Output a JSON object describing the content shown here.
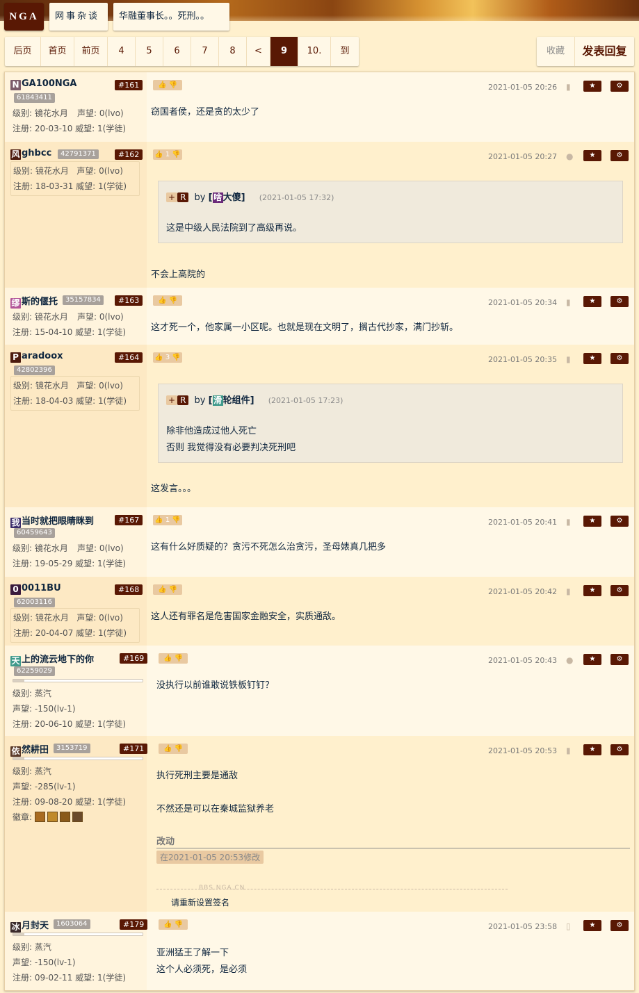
{
  "header": {
    "logo": "NGA",
    "forum": "网事杂谈",
    "thread": "华融董事长。。死刑。。"
  },
  "pager": {
    "items": [
      "后页",
      "首页",
      "前页",
      "4",
      "5",
      "6",
      "7",
      "8",
      "<",
      "9",
      "10.",
      "到"
    ],
    "current": "9"
  },
  "actions": {
    "favorite": "收藏",
    "reply": "发表回复"
  },
  "colors": {
    "brand": "#591804",
    "row_a": "#fff8e7",
    "row_b": "#fff0cd",
    "accent": "#e9c9a1"
  },
  "posts": [
    {
      "initial": "N",
      "initial_color": "#7b5b6a",
      "name": "GA100NGA",
      "uid": "61843411",
      "floor": "#161",
      "level": "级别: 镜花水月",
      "rep": "声望: 0(lvo)",
      "reg": "注册: 20-03-10 威望: 1(学徒)",
      "vote": "",
      "time": "2021-01-05 20:26",
      "device": "android-icon",
      "content": [
        "窃国者侯，还是贪的太少了"
      ]
    },
    {
      "initial": "风",
      "initial_color": "#4c1b0e",
      "name": "ghbcc",
      "uid": "42791371",
      "floor": "#162",
      "level": "级别: 镜花水月",
      "rep": "声望: 0(lvo)",
      "reg": "注册: 18-03-31 威望: 1(学徒)",
      "vote": "1",
      "time": "2021-01-05 20:27",
      "device": "apple-icon",
      "quote": {
        "plus": "+",
        "r": "R",
        "by": "by",
        "initial": "啥",
        "name": "大傻",
        "time": "(2021-01-05 17:32)",
        "lines": [
          "这是中级人民法院到了高级再说。"
        ]
      },
      "content": [
        "不会上高院的"
      ]
    },
    {
      "initial": "缪",
      "initial_color": "#b25599",
      "name": "斯的偃托",
      "uid": "35157834",
      "floor": "#163",
      "level": "级别: 镜花水月",
      "rep": "声望: 0(lvo)",
      "reg": "注册: 15-04-10 威望: 1(学徒)",
      "vote": "",
      "time": "2021-01-05 20:34",
      "device": "android-icon",
      "content": [
        "这才死一个，他家属一小区呢。也就是现在文明了，搁古代抄家，满门抄斩。"
      ]
    },
    {
      "initial": "P",
      "initial_color": "#4c1b0e",
      "name": "aradoox",
      "uid": "42802396",
      "floor": "#164",
      "level": "级别: 镜花水月",
      "rep": "声望: 0(lvo)",
      "reg": "注册: 18-04-03 威望: 1(学徒)",
      "vote": "3",
      "time": "2021-01-05 20:35",
      "device": "android-icon",
      "quote": {
        "plus": "+",
        "r": "R",
        "by": "by",
        "initial": "滑",
        "name": "轮组件",
        "time": "(2021-01-05 17:23)",
        "lines": [
          "除非他造成过他人死亡",
          "否则 我觉得没有必要判决死刑吧"
        ]
      },
      "content": [
        "这发言。。。"
      ]
    },
    {
      "initial": "我",
      "initial_color": "#3a2c6b",
      "name": "当时就把眼睛眯到",
      "uid": "60459643",
      "floor": "#167",
      "level": "级别: 镜花水月",
      "rep": "声望: 0(lvo)",
      "reg": "注册: 19-05-29 威望: 1(学徒)",
      "vote": "1",
      "time": "2021-01-05 20:41",
      "device": "android-icon",
      "content": [
        "这有什么好质疑的？贪污不死怎么治贪污，圣母婊真几把多"
      ]
    },
    {
      "initial": "0",
      "initial_color": "#3a1a3c",
      "name": "0011BU",
      "uid": "62003116",
      "floor": "#168",
      "level": "级别: 镜花水月",
      "rep": "声望: 0(lvo)",
      "reg": "注册: 20-04-07 威望: 1(学徒)",
      "vote": "",
      "time": "2021-01-05 20:42",
      "device": "android-icon",
      "content": [
        "这人还有罪名是危害国家金融安全，实质通敌。"
      ]
    },
    {
      "initial": "天",
      "initial_color": "#3f9a8b",
      "name": "上的流云地下的你",
      "uid": "62259029",
      "floor": "#169",
      "level": "级别: 蒸汽",
      "rep": "声望: -150(lv-1)",
      "reg": "注册: 20-06-10 威望: 1(学徒)",
      "vote": "",
      "time": "2021-01-05 20:43",
      "device": "apple-icon",
      "content": [
        "没执行以前谁敢说铁板钉钉？"
      ]
    },
    {
      "initial": "依",
      "initial_color": "#5a3a2a",
      "name": "然耕田",
      "uid": "3153719",
      "floor": "#171",
      "level": "级别: 蒸汽",
      "rep": "声望: -285(lv-1)",
      "reg": "注册: 09-08-20 威望: 1(学徒)",
      "medals_label": "徽章:",
      "vote": "",
      "time": "2021-01-05 20:53",
      "device": "android-icon",
      "content": [
        "执行死刑主要是通敌",
        "不然还是可以在秦城监狱养老"
      ],
      "edit_title": "改动",
      "edit_note": "在2021-01-05 20:53修改",
      "sig_watermark": "BBS.NGA.CN",
      "signature": "请重新设置签名"
    },
    {
      "initial": "冰",
      "initial_color": "#3a2a2a",
      "name": "月封天",
      "uid": "1603064",
      "floor": "#179",
      "level": "级别: 蒸汽",
      "rep": "声望: -150(lv-1)",
      "reg": "注册: 09-02-11  威望: 1(学徒)",
      "vote": "",
      "time": "2021-01-05 23:58",
      "device": "phone-icon",
      "content": [
        "亚洲猛王了解一下",
        "这个人必须死，是必须"
      ]
    }
  ]
}
